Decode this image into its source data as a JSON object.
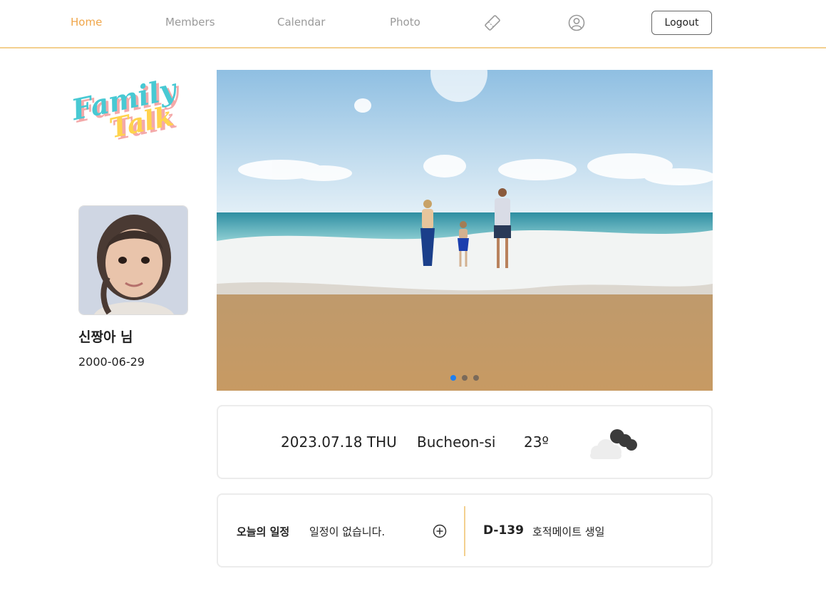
{
  "nav": {
    "items": [
      {
        "label": "Home",
        "active": true
      },
      {
        "label": "Members",
        "active": false
      },
      {
        "label": "Calendar",
        "active": false
      },
      {
        "label": "Photo",
        "active": false
      }
    ],
    "icons": [
      "ticket-icon",
      "user-circle-icon"
    ],
    "logout_label": "Logout"
  },
  "logo": {
    "line1": "Family",
    "line2": "Talk"
  },
  "profile": {
    "name": "신짱아 님",
    "birthdate": "2000-06-29"
  },
  "carousel": {
    "slide_count": 3,
    "active_index": 0
  },
  "weather": {
    "date": "2023.07.18 THU",
    "city": "Bucheon-si",
    "temperature": "23º",
    "icon": "cloudy-icon"
  },
  "schedule": {
    "label": "오늘의 일정",
    "empty_text": "일정이 없습니다.",
    "dday": "D-139",
    "event": "호적메이트 생일"
  },
  "colors": {
    "accent": "#f0a64a",
    "divider": "#f3d08f",
    "dot_active": "#1e7ff0"
  }
}
